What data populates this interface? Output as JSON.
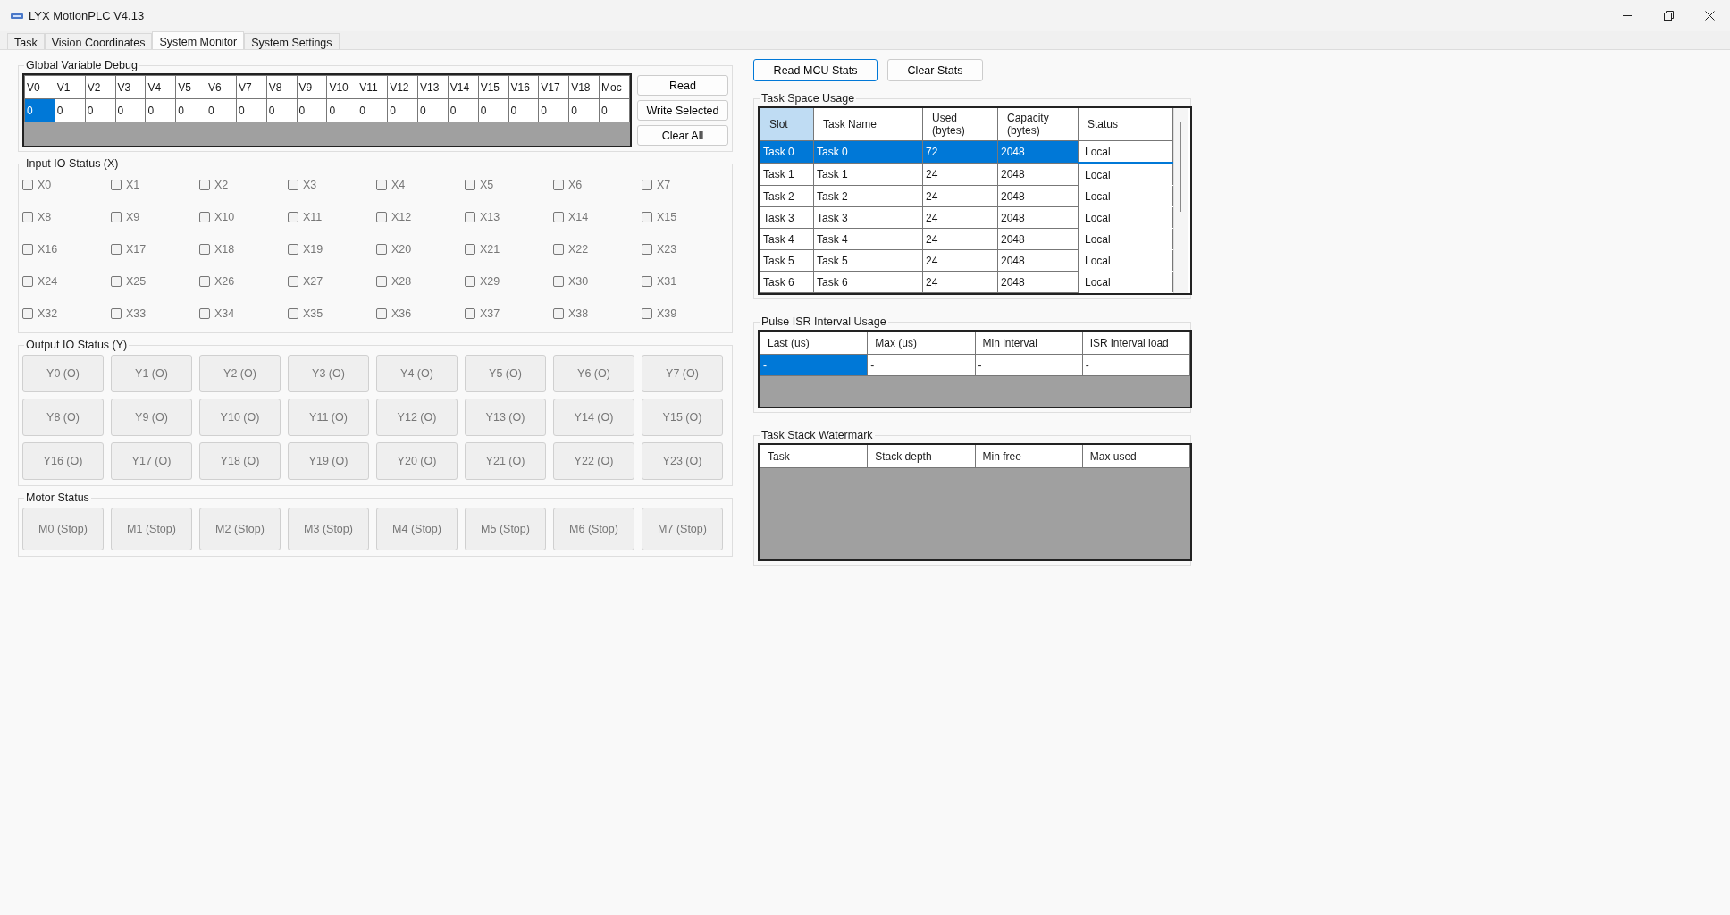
{
  "window": {
    "title": "LYX MotionPLC V4.13"
  },
  "tabs": [
    {
      "label": "Task",
      "selected": false
    },
    {
      "label": "Vision Coordinates",
      "selected": false
    },
    {
      "label": "System Monitor",
      "selected": true
    },
    {
      "label": "System Settings",
      "selected": false
    }
  ],
  "global_variable_debug": {
    "title": "Global Variable Debug",
    "columns": [
      "V0",
      "V1",
      "V2",
      "V3",
      "V4",
      "V5",
      "V6",
      "V7",
      "V8",
      "V9",
      "V10",
      "V11",
      "V12",
      "V13",
      "V14",
      "V15",
      "V16",
      "V17",
      "V18",
      "Moc"
    ],
    "values": [
      {
        "text": "0",
        "selected": true
      },
      {
        "text": "0",
        "selected": false
      },
      {
        "text": "0",
        "selected": false
      },
      {
        "text": "0",
        "selected": false
      },
      {
        "text": "0",
        "selected": false
      },
      {
        "text": "0",
        "selected": false
      },
      {
        "text": "0",
        "selected": false
      },
      {
        "text": "0",
        "selected": false
      },
      {
        "text": "0",
        "selected": false
      },
      {
        "text": "0",
        "selected": false
      },
      {
        "text": "0",
        "selected": false
      },
      {
        "text": "0",
        "selected": false
      },
      {
        "text": "0",
        "selected": false
      },
      {
        "text": "0",
        "selected": false
      },
      {
        "text": "0",
        "selected": false
      },
      {
        "text": "0",
        "selected": false
      },
      {
        "text": "0",
        "selected": false
      },
      {
        "text": "0",
        "selected": false
      },
      {
        "text": "0",
        "selected": false
      },
      {
        "text": "0",
        "selected": false
      }
    ],
    "buttons": [
      "Read",
      "Write Selected",
      "Clear All"
    ]
  },
  "input_io": {
    "title": "Input IO Status (X)",
    "inputs": [
      {
        "label": "X0",
        "checked": false
      },
      {
        "label": "X1",
        "checked": false
      },
      {
        "label": "X2",
        "checked": false
      },
      {
        "label": "X3",
        "checked": false
      },
      {
        "label": "X4",
        "checked": false
      },
      {
        "label": "X5",
        "checked": false
      },
      {
        "label": "X6",
        "checked": false
      },
      {
        "label": "X7",
        "checked": false
      },
      {
        "label": "X8",
        "checked": false
      },
      {
        "label": "X9",
        "checked": false
      },
      {
        "label": "X10",
        "checked": false
      },
      {
        "label": "X11",
        "checked": false
      },
      {
        "label": "X12",
        "checked": false
      },
      {
        "label": "X13",
        "checked": false
      },
      {
        "label": "X14",
        "checked": false
      },
      {
        "label": "X15",
        "checked": false
      },
      {
        "label": "X16",
        "checked": false
      },
      {
        "label": "X17",
        "checked": false
      },
      {
        "label": "X18",
        "checked": false
      },
      {
        "label": "X19",
        "checked": false
      },
      {
        "label": "X20",
        "checked": false
      },
      {
        "label": "X21",
        "checked": false
      },
      {
        "label": "X22",
        "checked": false
      },
      {
        "label": "X23",
        "checked": false
      },
      {
        "label": "X24",
        "checked": false
      },
      {
        "label": "X25",
        "checked": false
      },
      {
        "label": "X26",
        "checked": false
      },
      {
        "label": "X27",
        "checked": false
      },
      {
        "label": "X28",
        "checked": false
      },
      {
        "label": "X29",
        "checked": false
      },
      {
        "label": "X30",
        "checked": false
      },
      {
        "label": "X31",
        "checked": false
      },
      {
        "label": "X32",
        "checked": false
      },
      {
        "label": "X33",
        "checked": false
      },
      {
        "label": "X34",
        "checked": false
      },
      {
        "label": "X35",
        "checked": false
      },
      {
        "label": "X36",
        "checked": false
      },
      {
        "label": "X37",
        "checked": false
      },
      {
        "label": "X38",
        "checked": false
      },
      {
        "label": "X39",
        "checked": false
      }
    ]
  },
  "output_io": {
    "title": "Output IO Status (Y)",
    "outputs": [
      "Y0 (O)",
      "Y1 (O)",
      "Y2 (O)",
      "Y3 (O)",
      "Y4 (O)",
      "Y5 (O)",
      "Y6 (O)",
      "Y7 (O)",
      "Y8 (O)",
      "Y9 (O)",
      "Y10 (O)",
      "Y11 (O)",
      "Y12 (O)",
      "Y13 (O)",
      "Y14 (O)",
      "Y15 (O)",
      "Y16 (O)",
      "Y17 (O)",
      "Y18 (O)",
      "Y19 (O)",
      "Y20 (O)",
      "Y21 (O)",
      "Y22 (O)",
      "Y23 (O)"
    ]
  },
  "motor_status": {
    "title": "Motor Status",
    "motors": [
      "M0 (Stop)",
      "M1 (Stop)",
      "M2 (Stop)",
      "M3 (Stop)",
      "M4 (Stop)",
      "M5 (Stop)",
      "M6 (Stop)",
      "M7 (Stop)"
    ]
  },
  "stats_buttons": [
    "Read MCU Stats",
    "Clear Stats"
  ],
  "task_space_usage": {
    "title": "Task Space Usage",
    "columns": [
      {
        "label": "Slot",
        "selected": true
      },
      {
        "label": "Task Name",
        "selected": false
      },
      {
        "label": "Used (bytes)",
        "selected": false
      },
      {
        "label": "Capacity (bytes)",
        "selected": false
      },
      {
        "label": "Status",
        "selected": false
      }
    ],
    "rows": [
      {
        "cells": [
          "Task 0",
          "Task 0",
          "72",
          "2048",
          "Local"
        ],
        "selected": true
      },
      {
        "cells": [
          "Task 1",
          "Task 1",
          "24",
          "2048",
          "Local"
        ],
        "selected": false
      },
      {
        "cells": [
          "Task 2",
          "Task 2",
          "24",
          "2048",
          "Local"
        ],
        "selected": false
      },
      {
        "cells": [
          "Task 3",
          "Task 3",
          "24",
          "2048",
          "Local"
        ],
        "selected": false
      },
      {
        "cells": [
          "Task 4",
          "Task 4",
          "24",
          "2048",
          "Local"
        ],
        "selected": false
      },
      {
        "cells": [
          "Task 5",
          "Task 5",
          "24",
          "2048",
          "Local"
        ],
        "selected": false
      },
      {
        "cells": [
          "Task 6",
          "Task 6",
          "24",
          "2048",
          "Local"
        ],
        "selected": false
      }
    ]
  },
  "pulse_isr_interval_usage": {
    "title": "Pulse ISR Interval Usage",
    "columns": [
      "Last (us)",
      "Max (us)",
      "Min interval",
      "ISR interval load"
    ],
    "rows": [
      [
        {
          "text": "-",
          "selected": true
        },
        {
          "text": "-",
          "selected": false
        },
        {
          "text": "-",
          "selected": false
        },
        {
          "text": "-",
          "selected": false
        }
      ]
    ]
  },
  "task_stack_watermark": {
    "title": "Task Stack Watermark",
    "columns": [
      "Task",
      "Stack depth",
      "Min free",
      "Max used"
    ]
  }
}
